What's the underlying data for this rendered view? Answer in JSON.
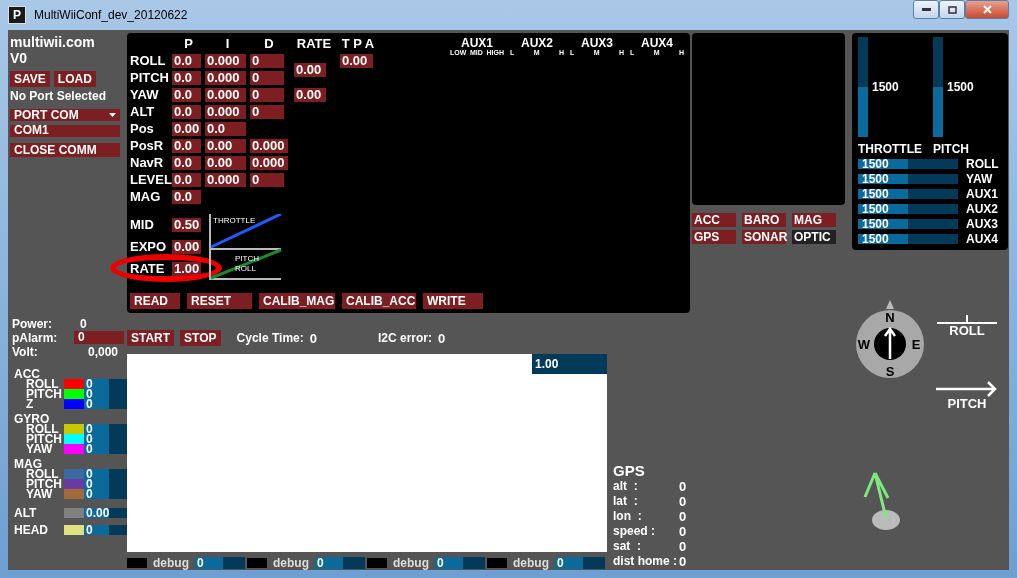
{
  "window": {
    "title": "MultiWiiConf_dev_20120622",
    "app_icon": "P"
  },
  "header": {
    "site": "multiwii.com",
    "version": "V0"
  },
  "file_buttons": [
    "SAVE",
    "LOAD"
  ],
  "port_status": "No Port Selected",
  "port": {
    "dropdown": "PORT COM",
    "option": "COM1",
    "close": "CLOSE COMM"
  },
  "power": [
    {
      "label": "Power:",
      "value": "0",
      "kind": "text"
    },
    {
      "label": "pAlarm:",
      "value": "0",
      "kind": "field"
    },
    {
      "label": "Volt:",
      "value": "0,000",
      "kind": "text"
    }
  ],
  "sensors": [
    {
      "name": "ACC",
      "channels": [
        {
          "label": "ROLL",
          "value": "0",
          "color": "#ff0000"
        },
        {
          "label": "PITCH",
          "value": "0",
          "color": "#00ff00"
        },
        {
          "label": "Z",
          "value": "0",
          "color": "#0000ff"
        }
      ]
    },
    {
      "name": "GYRO",
      "channels": [
        {
          "label": "ROLL",
          "value": "0",
          "color": "#c8c800"
        },
        {
          "label": "PITCH",
          "value": "0",
          "color": "#00ffff"
        },
        {
          "label": "YAW",
          "value": "0",
          "color": "#ff00ff"
        }
      ]
    },
    {
      "name": "MAG",
      "channels": [
        {
          "label": "ROLL",
          "value": "0",
          "color": "#3a6aa0"
        },
        {
          "label": "PITCH",
          "value": "0",
          "color": "#6a3aa0"
        },
        {
          "label": "YAW",
          "value": "0",
          "color": "#a06a3a"
        }
      ]
    }
  ],
  "extras": [
    {
      "label": "ALT",
      "value": "0.00",
      "color": "#808080"
    },
    {
      "label": "HEAD",
      "value": "0",
      "color": "#e0e080"
    }
  ],
  "pid": {
    "columns": [
      "P",
      "I",
      "D",
      "RATE",
      "T P A"
    ],
    "rows": [
      {
        "label": "ROLL",
        "p": "0.0",
        "i": "0.000",
        "d": "0",
        "rate": "0.00",
        "tpa": "0.00"
      },
      {
        "label": "PITCH",
        "p": "0.0",
        "i": "0.000",
        "d": "0"
      },
      {
        "label": "YAW",
        "p": "0.0",
        "i": "0.000",
        "d": "0",
        "rate": "0.00"
      },
      {
        "label": "ALT",
        "p": "0.0",
        "i": "0.000",
        "d": "0"
      },
      {
        "label": "Pos",
        "p": "0.00",
        "i": "0.0"
      },
      {
        "label": "PosR",
        "p": "0.0",
        "i": "0.00",
        "d": "0.000"
      },
      {
        "label": "NavR",
        "p": "0.0",
        "i": "0.00",
        "d": "0.000"
      },
      {
        "label": "LEVEL",
        "p": "0.0",
        "i": "0.000",
        "d": "0"
      },
      {
        "label": "MAG",
        "p": "0.0"
      }
    ]
  },
  "aux": [
    {
      "name": "AUX1",
      "levels": [
        "LOW",
        "MID",
        "HIGH"
      ]
    },
    {
      "name": "AUX2",
      "levels": [
        "L",
        "M",
        "H"
      ]
    },
    {
      "name": "AUX3",
      "levels": [
        "L",
        "M",
        "H"
      ]
    },
    {
      "name": "AUX4",
      "levels": [
        "L",
        "M",
        "H"
      ]
    }
  ],
  "throttle": {
    "rows": [
      {
        "label": "MID",
        "value": "0.50",
        "highlighted": false
      },
      {
        "label": "EXPO",
        "value": "0.00",
        "highlighted": false
      },
      {
        "label": "RATE",
        "value": "1.00",
        "highlighted": true
      }
    ],
    "curve_label": "THROTTLE",
    "rate_labels": [
      "PITCH",
      "ROLL"
    ]
  },
  "actions": [
    "READ",
    "RESET",
    "CALIB_MAG",
    "CALIB_ACC",
    "WRITE"
  ],
  "sensor_toggles": [
    {
      "label": "ACC",
      "on": true
    },
    {
      "label": "BARO",
      "on": true
    },
    {
      "label": "MAG",
      "on": true
    },
    {
      "label": "GPS",
      "on": true
    },
    {
      "label": "SONAR",
      "on": true
    },
    {
      "label": "OPTIC",
      "on": false
    }
  ],
  "rc": {
    "vertical": [
      {
        "name": "THROTTLE",
        "value": "1500",
        "level": 0.5
      },
      {
        "name": "PITCH",
        "value": "1500",
        "level": 0.5
      }
    ],
    "horizontal": [
      {
        "name": "ROLL",
        "value": "1500",
        "level": 0.5
      },
      {
        "name": "YAW",
        "value": "1500",
        "level": 0.5
      },
      {
        "name": "AUX1",
        "value": "1500",
        "level": 0.5
      },
      {
        "name": "AUX2",
        "value": "1500",
        "level": 0.5
      },
      {
        "name": "AUX3",
        "value": "1500",
        "level": 0.5
      },
      {
        "name": "AUX4",
        "value": "1500",
        "level": 0.5
      }
    ]
  },
  "monitor": {
    "buttons": [
      "START",
      "STOP"
    ],
    "stats": [
      {
        "label": "Cycle Time:",
        "value": "0"
      },
      {
        "label": "I2C error:",
        "value": "0"
      }
    ],
    "graph_scale": "1.00"
  },
  "gps": {
    "title": "GPS",
    "rows": [
      {
        "label": "alt  :",
        "value": "0"
      },
      {
        "label": "lat  :",
        "value": "0"
      },
      {
        "label": "lon  :",
        "value": "0"
      },
      {
        "label": "speed :",
        "value": "0"
      },
      {
        "label": "sat  :",
        "value": "0"
      },
      {
        "label": "dist home :",
        "value": "0"
      }
    ]
  },
  "debug": [
    {
      "label": "debug",
      "value": "0"
    },
    {
      "label": "debug",
      "value": "0"
    },
    {
      "label": "debug",
      "value": "0"
    },
    {
      "label": "debug",
      "value": "0"
    }
  ],
  "compass": {
    "labels": [
      "N",
      "E",
      "S",
      "W"
    ]
  },
  "attitude": [
    {
      "label": "ROLL",
      "kind": "roll"
    },
    {
      "label": "PITCH",
      "kind": "pitch"
    }
  ]
}
